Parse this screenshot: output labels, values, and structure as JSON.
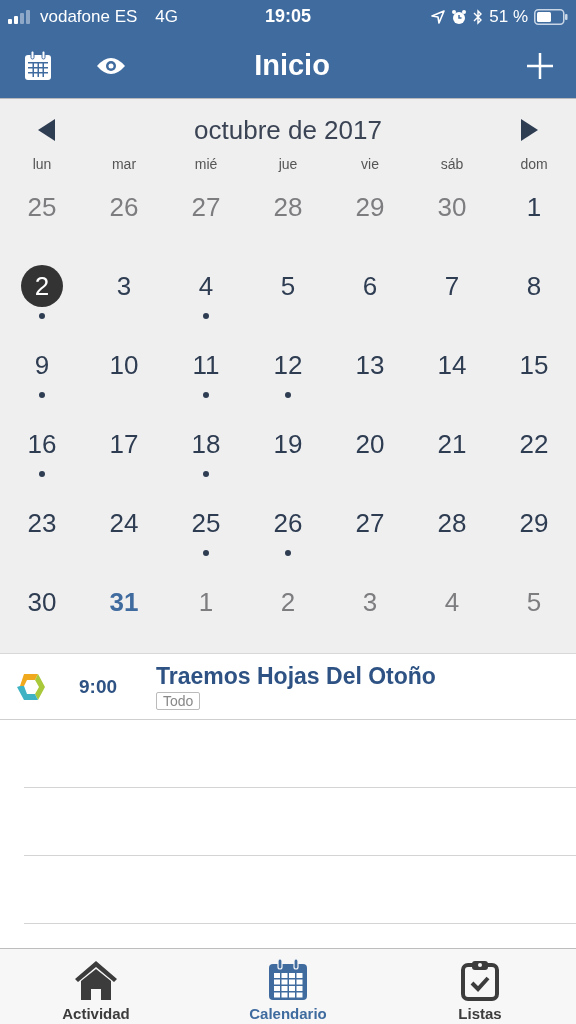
{
  "status_bar": {
    "carrier": "vodafone ES",
    "network": "4G",
    "time": "19:05",
    "battery": "51 %"
  },
  "nav": {
    "title": "Inicio"
  },
  "calendar": {
    "month": "octubre de 2017",
    "weekdays": [
      "lun",
      "mar",
      "mié",
      "jue",
      "vie",
      "sáb",
      "dom"
    ],
    "weeks": [
      [
        {
          "day": "25",
          "outside": true,
          "selected": false,
          "today": false,
          "dot": false
        },
        {
          "day": "26",
          "outside": true,
          "selected": false,
          "today": false,
          "dot": false
        },
        {
          "day": "27",
          "outside": true,
          "selected": false,
          "today": false,
          "dot": false
        },
        {
          "day": "28",
          "outside": true,
          "selected": false,
          "today": false,
          "dot": false
        },
        {
          "day": "29",
          "outside": true,
          "selected": false,
          "today": false,
          "dot": false
        },
        {
          "day": "30",
          "outside": true,
          "selected": false,
          "today": false,
          "dot": false
        },
        {
          "day": "1",
          "outside": false,
          "selected": false,
          "today": false,
          "dot": false
        }
      ],
      [
        {
          "day": "2",
          "outside": false,
          "selected": true,
          "today": false,
          "dot": true
        },
        {
          "day": "3",
          "outside": false,
          "selected": false,
          "today": false,
          "dot": false
        },
        {
          "day": "4",
          "outside": false,
          "selected": false,
          "today": false,
          "dot": true
        },
        {
          "day": "5",
          "outside": false,
          "selected": false,
          "today": false,
          "dot": false
        },
        {
          "day": "6",
          "outside": false,
          "selected": false,
          "today": false,
          "dot": false
        },
        {
          "day": "7",
          "outside": false,
          "selected": false,
          "today": false,
          "dot": false
        },
        {
          "day": "8",
          "outside": false,
          "selected": false,
          "today": false,
          "dot": false
        }
      ],
      [
        {
          "day": "9",
          "outside": false,
          "selected": false,
          "today": false,
          "dot": true
        },
        {
          "day": "10",
          "outside": false,
          "selected": false,
          "today": false,
          "dot": false
        },
        {
          "day": "11",
          "outside": false,
          "selected": false,
          "today": false,
          "dot": true
        },
        {
          "day": "12",
          "outside": false,
          "selected": false,
          "today": false,
          "dot": true
        },
        {
          "day": "13",
          "outside": false,
          "selected": false,
          "today": false,
          "dot": false
        },
        {
          "day": "14",
          "outside": false,
          "selected": false,
          "today": false,
          "dot": false
        },
        {
          "day": "15",
          "outside": false,
          "selected": false,
          "today": false,
          "dot": false
        }
      ],
      [
        {
          "day": "16",
          "outside": false,
          "selected": false,
          "today": false,
          "dot": true
        },
        {
          "day": "17",
          "outside": false,
          "selected": false,
          "today": false,
          "dot": false
        },
        {
          "day": "18",
          "outside": false,
          "selected": false,
          "today": false,
          "dot": true
        },
        {
          "day": "19",
          "outside": false,
          "selected": false,
          "today": false,
          "dot": false
        },
        {
          "day": "20",
          "outside": false,
          "selected": false,
          "today": false,
          "dot": false
        },
        {
          "day": "21",
          "outside": false,
          "selected": false,
          "today": false,
          "dot": false
        },
        {
          "day": "22",
          "outside": false,
          "selected": false,
          "today": false,
          "dot": false
        }
      ],
      [
        {
          "day": "23",
          "outside": false,
          "selected": false,
          "today": false,
          "dot": false
        },
        {
          "day": "24",
          "outside": false,
          "selected": false,
          "today": false,
          "dot": false
        },
        {
          "day": "25",
          "outside": false,
          "selected": false,
          "today": false,
          "dot": true
        },
        {
          "day": "26",
          "outside": false,
          "selected": false,
          "today": false,
          "dot": true
        },
        {
          "day": "27",
          "outside": false,
          "selected": false,
          "today": false,
          "dot": false
        },
        {
          "day": "28",
          "outside": false,
          "selected": false,
          "today": false,
          "dot": false
        },
        {
          "day": "29",
          "outside": false,
          "selected": false,
          "today": false,
          "dot": false
        }
      ],
      [
        {
          "day": "30",
          "outside": false,
          "selected": false,
          "today": false,
          "dot": false
        },
        {
          "day": "31",
          "outside": false,
          "selected": false,
          "today": true,
          "dot": false
        },
        {
          "day": "1",
          "outside": true,
          "selected": false,
          "today": false,
          "dot": false
        },
        {
          "day": "2",
          "outside": true,
          "selected": false,
          "today": false,
          "dot": false
        },
        {
          "day": "3",
          "outside": true,
          "selected": false,
          "today": false,
          "dot": false
        },
        {
          "day": "4",
          "outside": true,
          "selected": false,
          "today": false,
          "dot": false
        },
        {
          "day": "5",
          "outside": true,
          "selected": false,
          "today": false,
          "dot": false
        }
      ]
    ]
  },
  "events": [
    {
      "time": "9:00",
      "title": "Traemos Hojas Del Otoño",
      "tag": "Todo"
    }
  ],
  "tabs": [
    {
      "label": "Actividad",
      "kind": "home",
      "selected": false
    },
    {
      "label": "Calendario",
      "kind": "calendar",
      "selected": true
    },
    {
      "label": "Listas",
      "kind": "clipboard",
      "selected": false
    }
  ]
}
